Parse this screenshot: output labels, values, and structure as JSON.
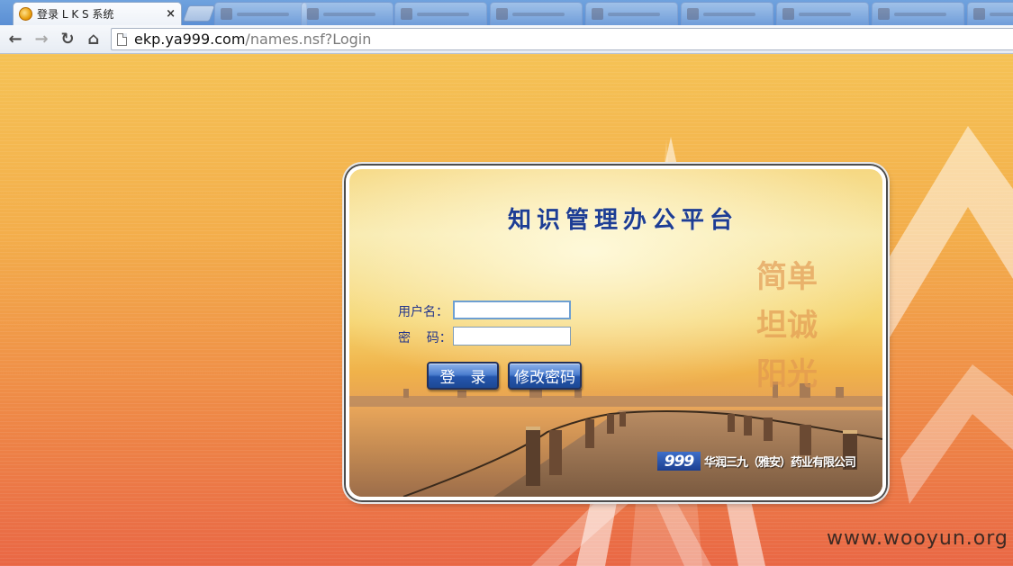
{
  "browser": {
    "active_tab": {
      "title": "登录 L K S 系统",
      "close_glyph": "×"
    },
    "nav": {
      "back_glyph": "←",
      "forward_glyph": "→",
      "reload_glyph": "↻",
      "home_glyph": "⌂"
    },
    "url": {
      "host": "ekp.ya999.com",
      "path": "/names.nsf?Login"
    }
  },
  "login": {
    "title": "知识管理办公平台",
    "slogans": [
      "简单",
      "坦诚",
      "阳光"
    ],
    "username_label": "用户名：",
    "password_label": "密    码：",
    "username_value": "",
    "password_value": "",
    "login_button": "登　录",
    "change_password_button": "修改密码",
    "brand_logo": "999",
    "brand_name": "华润三九（雅安）药业有限公司"
  },
  "watermark": "www.wooyun.org",
  "colors": {
    "title": "#1d3d94",
    "label": "#23358c",
    "button": "#2556ad",
    "page_top": "#f5c255",
    "page_bottom": "#e96745"
  }
}
